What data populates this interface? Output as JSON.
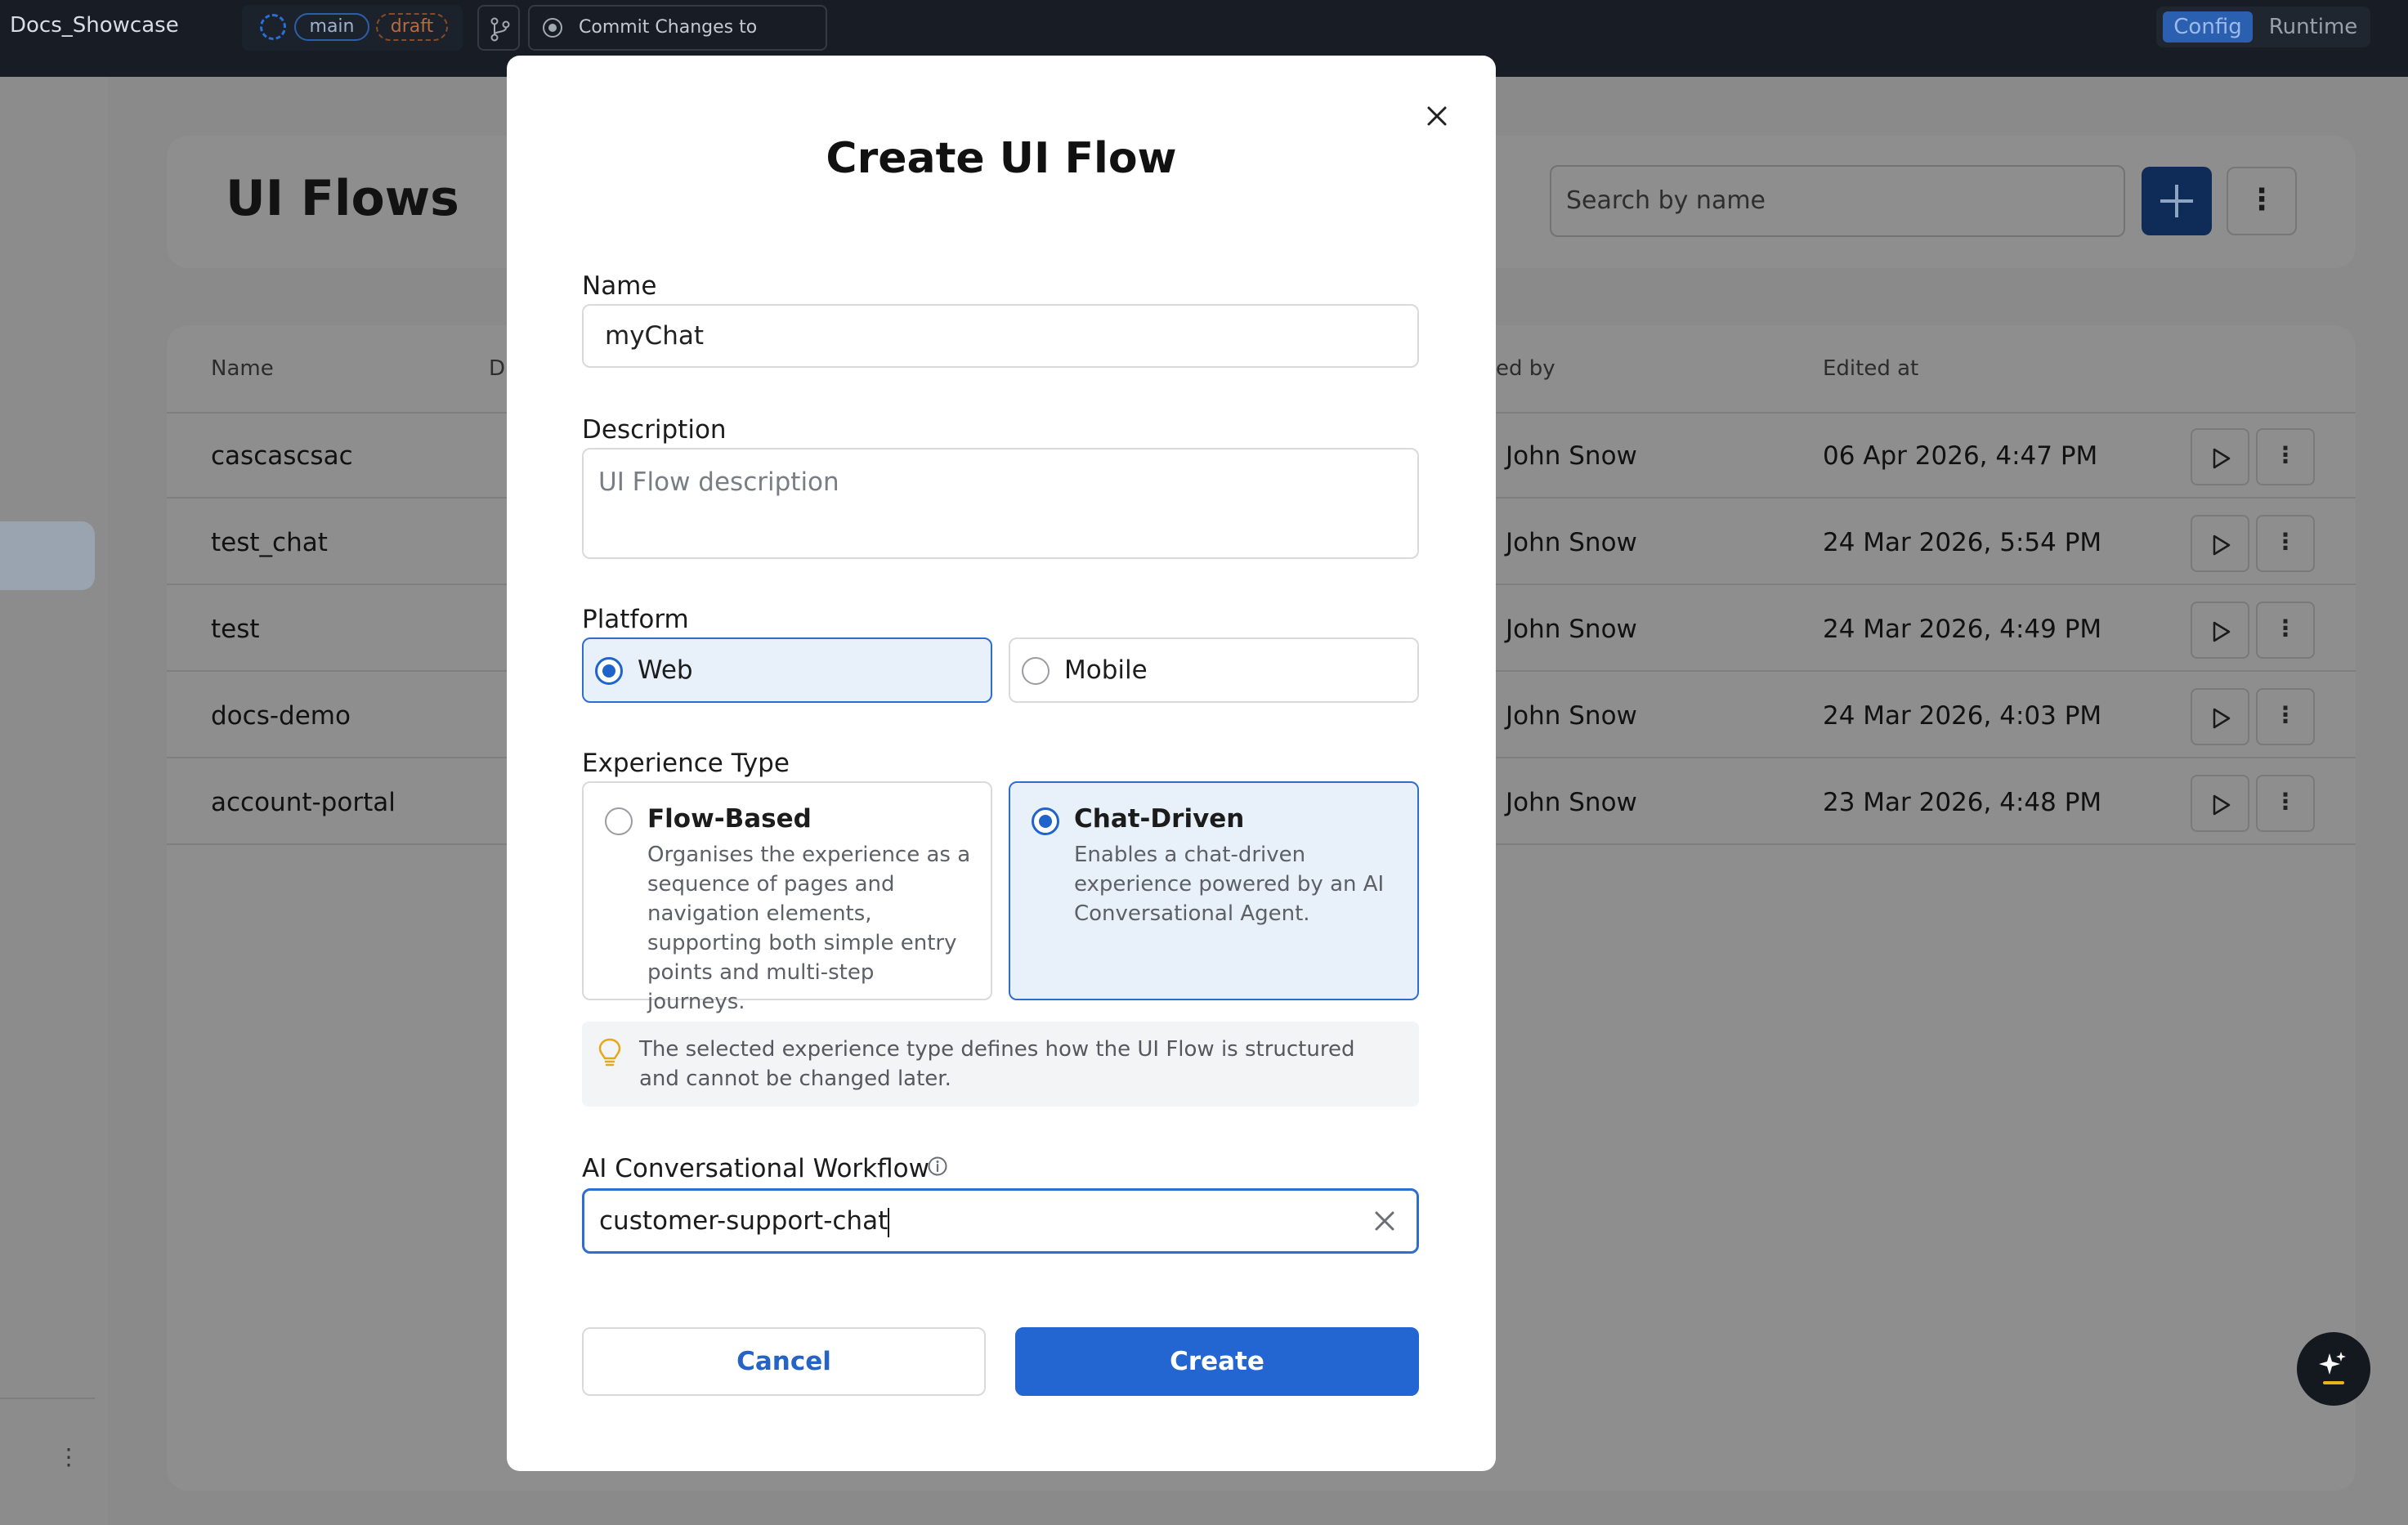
{
  "app": {
    "title": "Docs_Showcase"
  },
  "topbar": {
    "branch": "main",
    "state": "draft",
    "commit_label": "Commit Changes to Version",
    "mode_config": "Config",
    "mode_runtime": "Runtime"
  },
  "page": {
    "title": "UI Flows",
    "search_placeholder": "Search by name"
  },
  "table": {
    "columns": {
      "name": "Name",
      "description": "D",
      "edited_by": "ed by",
      "edited_at": "Edited at"
    },
    "rows": [
      {
        "name": "cascascsac",
        "edited_by": "John Snow",
        "edited_at": "06 Apr 2026, 4:47 PM"
      },
      {
        "name": "test_chat",
        "edited_by": "John Snow",
        "edited_at": "24 Mar 2026, 5:54 PM"
      },
      {
        "name": "test",
        "edited_by": "John Snow",
        "edited_at": "24 Mar 2026, 4:49 PM"
      },
      {
        "name": "docs-demo",
        "edited_by": "John Snow",
        "edited_at": "24 Mar 2026, 4:03 PM"
      },
      {
        "name": "account-portal",
        "edited_by": "John Snow",
        "edited_at": "23 Mar 2026, 4:48 PM"
      }
    ]
  },
  "modal": {
    "title": "Create UI Flow",
    "name_label": "Name",
    "name_value": "myChat",
    "description_label": "Description",
    "description_placeholder": "UI Flow description",
    "platform_label": "Platform",
    "platform_options": [
      "Web",
      "Mobile"
    ],
    "platform_selected": "Web",
    "experience_label": "Experience Type",
    "experience_options": [
      {
        "title": "Flow-Based",
        "description": "Organises the experience as a sequence of pages and navigation elements, supporting both simple entry points and multi-step journeys."
      },
      {
        "title": "Chat-Driven",
        "description": "Enables a chat-driven experience powered by an AI Conversational Agent."
      }
    ],
    "experience_selected": "Chat-Driven",
    "info_text": "The selected experience type defines how the UI Flow is structured and cannot be changed later.",
    "workflow_label": "AI Conversational Workflow",
    "workflow_value": "customer-support-chat",
    "cancel_label": "Cancel",
    "create_label": "Create"
  },
  "colors": {
    "accent": "#2466d1",
    "selected_bg": "#e8f0fa",
    "topbar_bg": "#181d25",
    "overlay_bg": "#8e8e8e"
  },
  "icons": [
    "ring-icon",
    "branch-icon",
    "commit-icon",
    "plus-icon",
    "kebab-icon",
    "play-icon",
    "close-icon",
    "bulb-icon",
    "info-icon",
    "clear-icon",
    "ai-sparkle-icon"
  ]
}
